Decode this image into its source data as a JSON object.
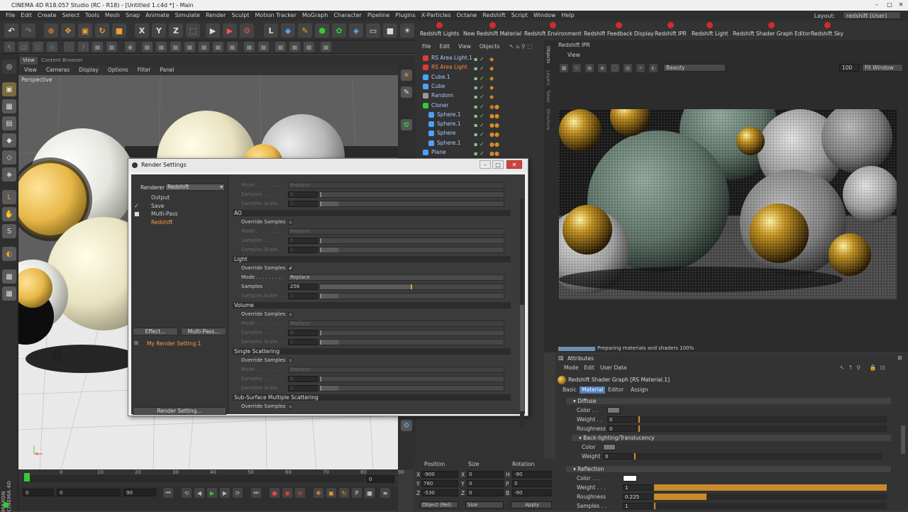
{
  "window": {
    "title": "CINEMA 4D R18.057 Studio (RC - R18) - [Untitled 1.c4d *] - Main"
  },
  "menu": [
    "File",
    "Edit",
    "Create",
    "Select",
    "Tools",
    "Mesh",
    "Snap",
    "Animate",
    "Simulate",
    "Render",
    "Sculpt",
    "Motion Tracker",
    "MoGraph",
    "Character",
    "Pipeline",
    "Plugins",
    "X-Particles",
    "Octane",
    "Redshift",
    "Script",
    "Window",
    "Help"
  ],
  "layout": {
    "label": "Layout:",
    "value": "redshift (User)"
  },
  "toolbar_axes": [
    "X",
    "Y",
    "Z"
  ],
  "redshift_bar": [
    "Redshift Lights",
    "New Redshift Material",
    "Redshift Environment",
    "Redshift Feedback Display",
    "Redshift IPR",
    "Redshift Light",
    "Redshift Shader Graph Editor",
    "Redshift Sky"
  ],
  "viewport": {
    "tabs": [
      "View",
      "Content Browser"
    ],
    "menu": [
      "View",
      "Cameras",
      "Display",
      "Options",
      "Filter",
      "Panel"
    ],
    "label": "Perspective"
  },
  "timeline": {
    "ticks": [
      "0",
      "10",
      "20",
      "30",
      "40",
      "50",
      "60",
      "70",
      "80",
      "90"
    ],
    "end_field": "0",
    "start": "0",
    "min": "0",
    "max": "90",
    "end": "90"
  },
  "objects": {
    "menu": [
      "File",
      "Edit",
      "View",
      "Objects"
    ],
    "items": [
      {
        "name": "RS Area Light.1",
        "indent": 0,
        "selected": false
      },
      {
        "name": "RS Area Light",
        "indent": 0,
        "selected": true
      },
      {
        "name": "Cube.1",
        "indent": 0,
        "selected": false
      },
      {
        "name": "Cube",
        "indent": 0,
        "selected": false
      },
      {
        "name": "Random",
        "indent": 0,
        "selected": false
      },
      {
        "name": "Cloner",
        "indent": 0,
        "selected": false
      },
      {
        "name": "Sphere.1",
        "indent": 1,
        "selected": false
      },
      {
        "name": "Sphere.1",
        "indent": 1,
        "selected": false
      },
      {
        "name": "Sphere",
        "indent": 1,
        "selected": false
      },
      {
        "name": "Sphere.1",
        "indent": 1,
        "selected": false
      },
      {
        "name": "Plane",
        "indent": 0,
        "selected": false
      }
    ]
  },
  "side_tabs": [
    "Objects",
    "Layers",
    "Takes",
    "Structure"
  ],
  "ipr": {
    "title": "Redshift IPR",
    "menu": "View",
    "aov": "Beauty",
    "zoom": "100",
    "fit": "Fit Window",
    "progress_text": "Preparing materials and shaders 100%",
    "progress": 1.0
  },
  "coords": {
    "headers": [
      "Position",
      "Size",
      "Rotation"
    ],
    "rows": [
      {
        "a": "X",
        "pos": "-900",
        "b": "X",
        "size": "0",
        "c": "H",
        "rot": "-90"
      },
      {
        "a": "Y",
        "pos": "780",
        "b": "Y",
        "size": "0",
        "c": "P",
        "rot": "0"
      },
      {
        "a": "Z",
        "pos": "-530",
        "b": "Z",
        "size": "0",
        "c": "B",
        "rot": "-90"
      }
    ],
    "mode": "Object (Rel)",
    "size_mode": "Size",
    "apply": "Apply"
  },
  "attributes": {
    "title": "Attributes",
    "menu": [
      "Mode",
      "Edit",
      "User Data"
    ],
    "shader": "Redshift Shader Graph [RS Material.1]",
    "tabs": [
      "Basic",
      "Material",
      "Editor",
      "Assign"
    ],
    "active_tab": "Material",
    "diffuse": {
      "header": "Diffuse",
      "color_label": "Color . .",
      "weight_label": "Weight . .",
      "weight": "0",
      "rough_label": "Roughness",
      "rough": "0"
    },
    "backlight": {
      "header": "Back-lighting/Translucency",
      "color_label": "Color",
      "weight_label": "Weight",
      "weight": "0"
    },
    "reflection": {
      "header": "Reflection",
      "color_label": "Color . . .",
      "weight_label": "Weight . . .",
      "weight": "1",
      "weight_frac": 1.0,
      "rough_label": "Roughness",
      "rough": "0.225",
      "rough_frac": 0.225,
      "samples_label": "Samples . .",
      "samples": "1"
    }
  },
  "render_settings": {
    "title": "Render Settings",
    "renderer_label": "Renderer",
    "renderer": "Redshift",
    "items": [
      {
        "name": "Output",
        "check": ""
      },
      {
        "name": "Save",
        "check": "✓"
      },
      {
        "name": "Multi-Pass",
        "check": "■"
      },
      {
        "name": "Redshift",
        "check": ""
      }
    ],
    "effect_btn": "Effect...",
    "multipass_btn": "Multi-Pass...",
    "setting_name": "My Render Setting.1",
    "render_setting_btn": "Render Setting...",
    "sections": [
      {
        "head": "",
        "rows": [
          {
            "kind": "dd",
            "label": "Mode . . . . . . . . .",
            "value": "Replace",
            "dim": true
          },
          {
            "kind": "num",
            "label": "Samples . . . . . . .",
            "value": "8",
            "dim": true,
            "frac": 0.0
          },
          {
            "kind": "num",
            "label": "Samples Scale . . .",
            "value": "1",
            "dim": true,
            "frac": 0.1
          }
        ]
      },
      {
        "head": "AO",
        "rows": [
          {
            "kind": "cb",
            "label": "Override Samples",
            "value": "",
            "dim": false
          },
          {
            "kind": "dd",
            "label": "Mode . . . . . . . . .",
            "value": "Replace",
            "dim": true
          },
          {
            "kind": "num",
            "label": "Samples . . . . . . .",
            "value": "8",
            "dim": true,
            "frac": 0.0
          },
          {
            "kind": "num",
            "label": "Samples Scale . . .",
            "value": "1",
            "dim": true,
            "frac": 0.1
          }
        ]
      },
      {
        "head": "Light",
        "rows": [
          {
            "kind": "cb",
            "label": "Override Samples",
            "value": "✓",
            "dim": false
          },
          {
            "kind": "dd",
            "label": "Mode . . . . . . . . .",
            "value": "Replace",
            "dim": false
          },
          {
            "kind": "num",
            "label": "Samples",
            "value": "256",
            "dim": false,
            "frac": 0.5
          },
          {
            "kind": "num",
            "label": "Samples Scale . . .",
            "value": "1",
            "dim": true,
            "frac": 0.1
          }
        ]
      },
      {
        "head": "Volume",
        "rows": [
          {
            "kind": "cb",
            "label": "Override Samples",
            "value": "",
            "dim": false
          },
          {
            "kind": "dd",
            "label": "Mode . . . . . . . . .",
            "value": "Replace",
            "dim": true
          },
          {
            "kind": "num",
            "label": "Samples . . . . . . .",
            "value": "8",
            "dim": true,
            "frac": 0.0
          },
          {
            "kind": "num",
            "label": "Samples Scale . . .",
            "value": "1",
            "dim": true,
            "frac": 0.1
          }
        ]
      },
      {
        "head": "Single Scattering",
        "rows": [
          {
            "kind": "cb",
            "label": "Override Samples",
            "value": "",
            "dim": false
          },
          {
            "kind": "dd",
            "label": "Mode . . . . . . . . .",
            "value": "Replace",
            "dim": true
          },
          {
            "kind": "num",
            "label": "Samples . . . . . . .",
            "value": "8",
            "dim": true,
            "frac": 0.0
          },
          {
            "kind": "num",
            "label": "Samples Scale . . .",
            "value": "1",
            "dim": true,
            "frac": 0.1
          }
        ]
      },
      {
        "head": "Sub-Surface Multiple Scattering",
        "rows": [
          {
            "kind": "cb",
            "label": "Override Samples",
            "value": "",
            "dim": false
          }
        ]
      }
    ]
  },
  "brand": {
    "vertical": "MAXON CINEMA 4D"
  },
  "colors": {
    "accent": "#ff8a3d",
    "selection": "#4f7fb8",
    "redshift": "#d42a2a",
    "slider": "#e9a12a"
  }
}
